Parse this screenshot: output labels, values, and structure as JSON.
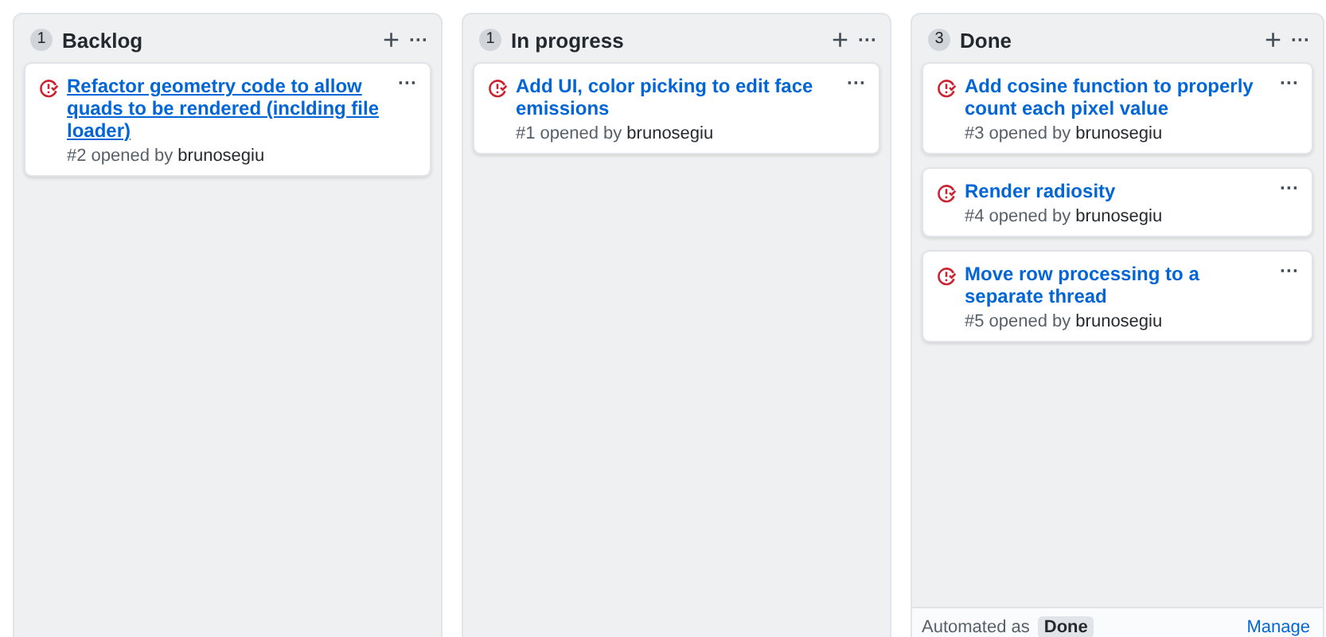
{
  "columns": [
    {
      "count": "1",
      "title": "Backlog",
      "add": "+",
      "menu": "···",
      "cards": [
        {
          "title": "Refactor geometry code to allow quads to be rendered (inclding file loader)",
          "hovered": true,
          "meta": "#2 opened by",
          "author": "brunosegiu",
          "menu": "···"
        }
      ]
    },
    {
      "count": "1",
      "title": "In progress",
      "add": "+",
      "menu": "···",
      "cards": [
        {
          "title": "Add UI, color picking to edit face emissions",
          "hovered": false,
          "meta": "#1 opened by",
          "author": "brunosegiu",
          "menu": "···"
        }
      ]
    },
    {
      "count": "3",
      "title": "Done",
      "add": "+",
      "menu": "···",
      "cards": [
        {
          "title": "Add cosine function to properly count each pixel value",
          "hovered": false,
          "meta": "#3 opened by",
          "author": "brunosegiu",
          "menu": "···"
        },
        {
          "title": "Render radiosity",
          "hovered": false,
          "meta": "#4 opened by",
          "author": "brunosegiu",
          "menu": "···"
        },
        {
          "title": "Move row processing to a separate thread",
          "hovered": false,
          "meta": "#5 opened by",
          "author": "brunosegiu",
          "menu": "···"
        }
      ],
      "footer": {
        "label": "Automated as",
        "tag": "Done",
        "link": "Manage"
      }
    }
  ]
}
